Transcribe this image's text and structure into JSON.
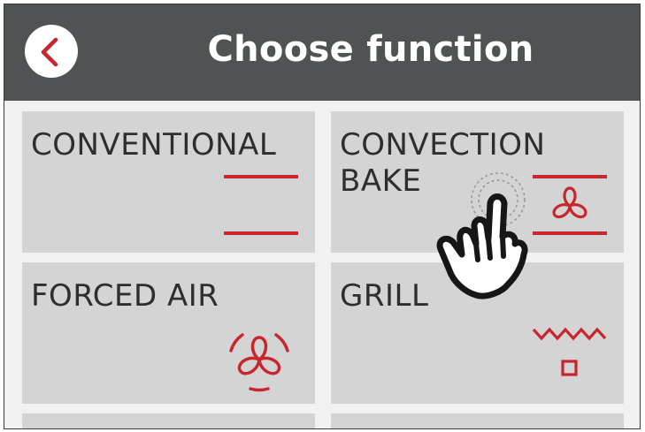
{
  "header": {
    "title": "Choose function",
    "back_icon": "chevron-left-icon"
  },
  "functions": [
    {
      "label": "CONVENTIONAL",
      "icon": "top-bottom-heat-icon"
    },
    {
      "label": "CONVECTION BAKE",
      "icon": "fan-with-heat-icon"
    },
    {
      "label": "FORCED AIR",
      "icon": "fan-icon"
    },
    {
      "label": "GRILL",
      "icon": "grill-icon"
    }
  ],
  "overlay": {
    "icon": "tap-hand-icon"
  },
  "colors": {
    "header_bg": "#4f5353",
    "accent_red": "#c8262d",
    "tile_bg": "#d4d4d4",
    "screen_bg": "#f1f1f1",
    "text_dark": "#2e2e2e"
  }
}
